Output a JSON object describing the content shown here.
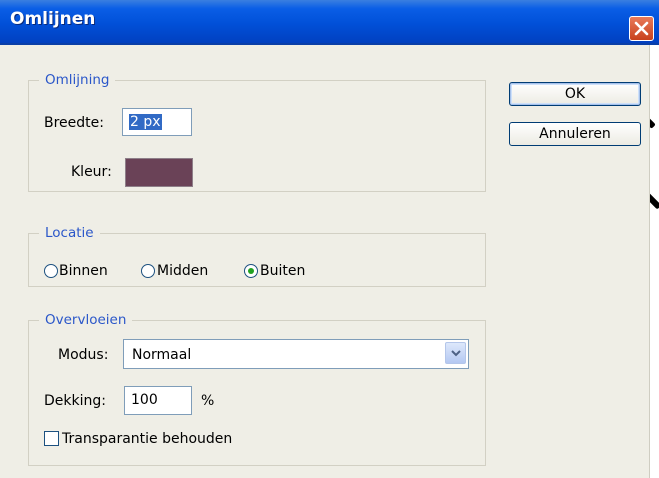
{
  "dialog": {
    "title": "Omlijnen"
  },
  "omlijning": {
    "legend": "Omlijning",
    "breedte_label": "Breedte:",
    "breedte_value": "2 px",
    "kleur_label": "Kleur:",
    "kleur_color": "#6a4257"
  },
  "locatie": {
    "legend": "Locatie",
    "options": [
      {
        "label": "Binnen",
        "selected": false
      },
      {
        "label": "Midden",
        "selected": false
      },
      {
        "label": "Buiten",
        "selected": true
      }
    ]
  },
  "overvloeien": {
    "legend": "Overvloeien",
    "modus_label": "Modus:",
    "modus_value": "Normaal",
    "dekking_label": "Dekking:",
    "dekking_value": "100",
    "dekking_unit": "%",
    "transparantie_label": "Transparantie behouden",
    "transparantie_checked": false
  },
  "buttons": {
    "ok": "OK",
    "cancel": "Annuleren"
  },
  "colors": {
    "titlebar": "#0150d8",
    "legend_text": "#2b57c9",
    "radio_selected": "#21a121",
    "close_button": "#c8411c"
  }
}
